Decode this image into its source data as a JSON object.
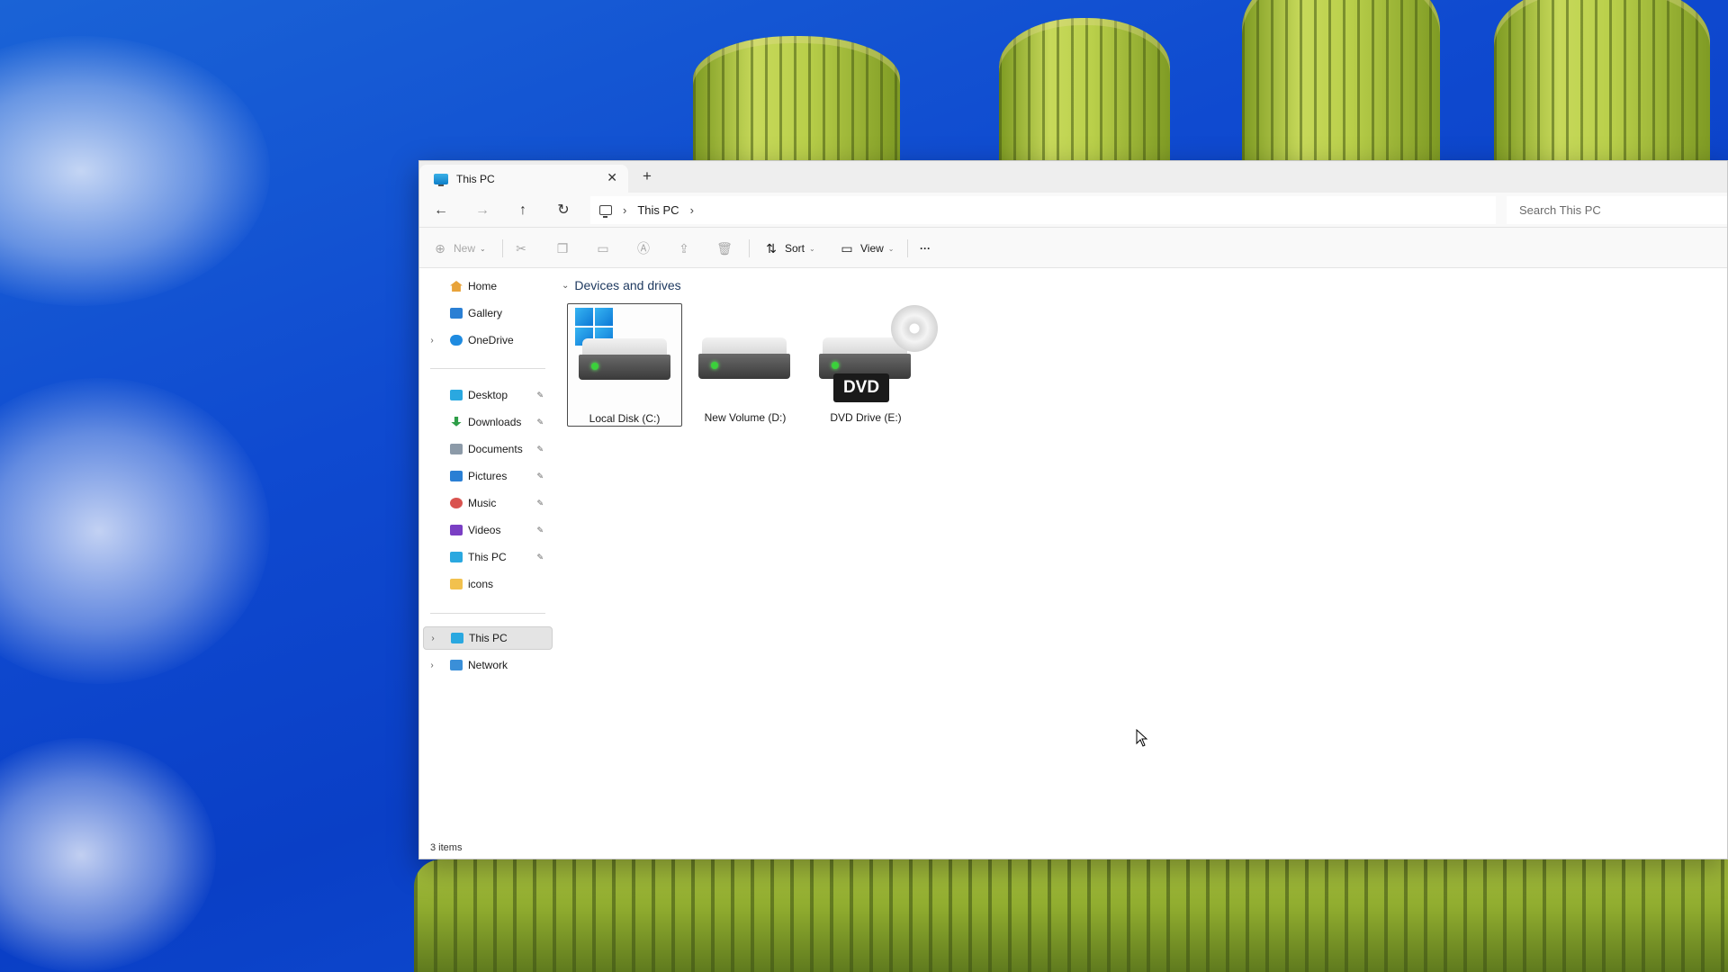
{
  "window": {
    "tab_title": "This PC",
    "tab_close": "✕",
    "new_tab": "+"
  },
  "nav_buttons": {
    "back": "←",
    "forward": "→",
    "up": "↑",
    "refresh": "↻"
  },
  "address": {
    "crumbs": [
      "This PC"
    ],
    "separator": "›",
    "search_placeholder": "Search This PC"
  },
  "toolbar": {
    "new_label": "New",
    "sort_label": "Sort",
    "view_label": "View",
    "more_label": "···",
    "caret": "⌄"
  },
  "sidebar": {
    "top": [
      {
        "label": "Home",
        "icon": "home-icon",
        "color": "#e8a33a"
      },
      {
        "label": "Gallery",
        "icon": "gallery-icon",
        "color": "#2a7fd4"
      },
      {
        "label": "OneDrive",
        "icon": "onedrive-icon",
        "color": "#1f8be0"
      }
    ],
    "pinned": [
      {
        "label": "Desktop",
        "icon": "desktop-icon",
        "color": "#2aa8e0"
      },
      {
        "label": "Downloads",
        "icon": "downloads-icon",
        "color": "#2e9e48"
      },
      {
        "label": "Documents",
        "icon": "documents-icon",
        "color": "#8c9aa8"
      },
      {
        "label": "Pictures",
        "icon": "pictures-icon",
        "color": "#2a7fd4"
      },
      {
        "label": "Music",
        "icon": "music-icon",
        "color": "#d9534f"
      },
      {
        "label": "Videos",
        "icon": "videos-icon",
        "color": "#7a3fc4"
      },
      {
        "label": "This PC",
        "icon": "this-pc-icon",
        "color": "#2aa8e0"
      },
      {
        "label": "icons",
        "icon": "folder-icon",
        "color": "#f2c14e"
      }
    ],
    "bottom": [
      {
        "label": "This PC",
        "icon": "this-pc-icon",
        "color": "#2aa8e0"
      },
      {
        "label": "Network",
        "icon": "network-icon",
        "color": "#3a8fd8"
      }
    ],
    "pin_glyph": "📌",
    "chevron": "›"
  },
  "content": {
    "group_title": "Devices and drives",
    "group_chevron": "⌄",
    "drives": [
      {
        "label": "Local Disk (C:)",
        "icon": "local-disk-icon"
      },
      {
        "label": "New Volume (D:)",
        "icon": "hard-drive-icon"
      },
      {
        "label": "DVD Drive (E:)",
        "icon": "dvd-drive-icon",
        "badge": "DVD"
      }
    ]
  },
  "status": {
    "item_count": "3 items"
  }
}
